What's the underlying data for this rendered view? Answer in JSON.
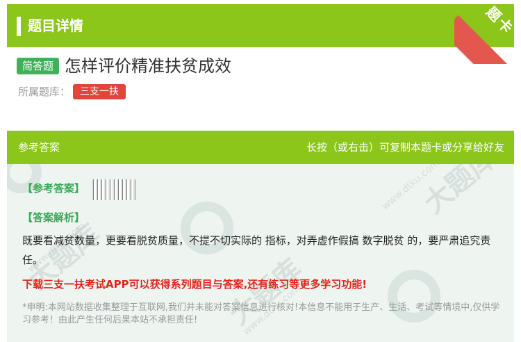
{
  "header": {
    "title": "题目详情"
  },
  "ribbon": {
    "text": "题卡"
  },
  "question": {
    "type_badge": "简答题",
    "title": "怎样评价精准扶贫成效",
    "bank_label": "所属题库：",
    "bank_name": "三支一扶"
  },
  "answer_card": {
    "head_left": "参考答案",
    "head_right": "长按（或右击）可复制本题卡或分享给好友",
    "answer_label": "【参考答案】",
    "explanation_label": "【答案解析】",
    "explanation_text": "既要看减贫数量，更要看脱贫质量，不提不切实际的 指标，对弄虚作假搞 数字脱贫 的，要严肃追究责任。",
    "promo_text": "下载三支一扶考试APP可以获得系列题目与答案,还有练习等更多学习功能!",
    "disclaimer": "*申明:本网站数据收集整理于互联网,我们并未能对答案信息进行核对!本信息不能用于生产、生活、考试等情境中,仅供学习参考！由此产生任何后果本站不承担责任!"
  },
  "watermarks": {
    "brand": "大题库",
    "url": "www.dtku.com"
  },
  "colors": {
    "brand_green": "#8cc61a",
    "badge_green": "#42b05a",
    "tag_red": "#e2453c",
    "promo_red": "#e2231a"
  }
}
